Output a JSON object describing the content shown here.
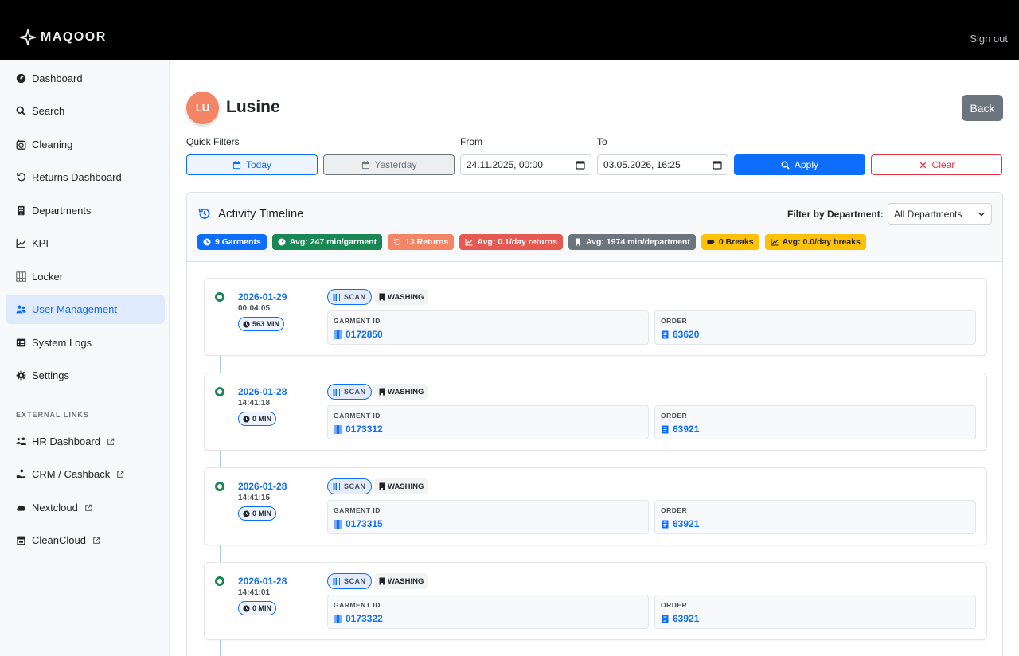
{
  "header": {
    "brand": "MAQOOR",
    "sign_out": "Sign out"
  },
  "sidebar": {
    "items": [
      {
        "label": "Dashboard",
        "icon": "gauge-icon"
      },
      {
        "label": "Search",
        "icon": "search-icon"
      },
      {
        "label": "Cleaning",
        "icon": "washing-machine-icon"
      },
      {
        "label": "Returns Dashboard",
        "icon": "undo-icon"
      },
      {
        "label": "Departments",
        "icon": "building-icon"
      },
      {
        "label": "KPI",
        "icon": "line-chart-icon"
      },
      {
        "label": "Locker",
        "icon": "grid-icon"
      },
      {
        "label": "User Management",
        "icon": "users-icon",
        "active": true
      },
      {
        "label": "System Logs",
        "icon": "list-icon"
      },
      {
        "label": "Settings",
        "icon": "gear-icon"
      }
    ],
    "external_heading": "EXTERNAL LINKS",
    "external": [
      {
        "label": "HR Dashboard",
        "icon": "people-icon"
      },
      {
        "label": "CRM / Cashback",
        "icon": "hand-coin-icon"
      },
      {
        "label": "Nextcloud",
        "icon": "cloud-icon"
      },
      {
        "label": "CleanCloud",
        "icon": "store-icon"
      }
    ]
  },
  "user": {
    "initials": "LU",
    "name": "Lusine",
    "back_label": "Back"
  },
  "filters": {
    "quick_label": "Quick Filters",
    "today": "Today",
    "yesterday": "Yesterday",
    "from_label": "From",
    "from_value": "24.11.2025, 00:00",
    "to_label": "To",
    "to_value": "03.05.2026, 16:25",
    "apply": "Apply",
    "clear": "Clear"
  },
  "timeline": {
    "title": "Activity Timeline",
    "dept_label": "Filter by Department:",
    "dept_value": "All Departments",
    "badges": [
      {
        "text": "9 Garments",
        "color": "#0d6efd",
        "icon": "clock-icon",
        "text_color": "#ffffff"
      },
      {
        "text": "Avg: 247 min/garment",
        "color": "#198754",
        "icon": "gauge-icon",
        "text_color": "#ffffff"
      },
      {
        "text": "13 Returns",
        "color": "#f48466",
        "icon": "undo-icon",
        "text_color": "#ffffff"
      },
      {
        "text": "Avg: 0.1/day returns",
        "color": "#e45a52",
        "icon": "line-chart-icon",
        "text_color": "#ffffff"
      },
      {
        "text": "Avg: 1974 min/department",
        "color": "#6c757d",
        "icon": "building-icon",
        "text_color": "#ffffff"
      },
      {
        "text": "0 Breaks",
        "color": "#ffc107",
        "icon": "coffee-icon",
        "text_color": "#212529"
      },
      {
        "text": "Avg: 0.0/day breaks",
        "color": "#ffc107",
        "icon": "line-chart-icon",
        "text_color": "#212529"
      }
    ],
    "entries": [
      {
        "date": "2026-01-29",
        "time": "00:04:05",
        "duration": "563 MIN",
        "action": "SCAN",
        "department": "WASHING",
        "garment_label": "GARMENT ID",
        "garment_id": "0172850",
        "order_label": "ORDER",
        "order": "63620"
      },
      {
        "date": "2026-01-28",
        "time": "14:41:18",
        "duration": "0 MIN",
        "action": "SCAN",
        "department": "WASHING",
        "garment_label": "GARMENT ID",
        "garment_id": "0173312",
        "order_label": "ORDER",
        "order": "63921"
      },
      {
        "date": "2026-01-28",
        "time": "14:41:15",
        "duration": "0 MIN",
        "action": "SCAN",
        "department": "WASHING",
        "garment_label": "GARMENT ID",
        "garment_id": "0173315",
        "order_label": "ORDER",
        "order": "63921"
      },
      {
        "date": "2026-01-28",
        "time": "14:41:01",
        "duration": "0 MIN",
        "action": "SCAN",
        "department": "WASHING",
        "garment_label": "GARMENT ID",
        "garment_id": "0173322",
        "order_label": "ORDER",
        "order": "63921"
      }
    ]
  }
}
